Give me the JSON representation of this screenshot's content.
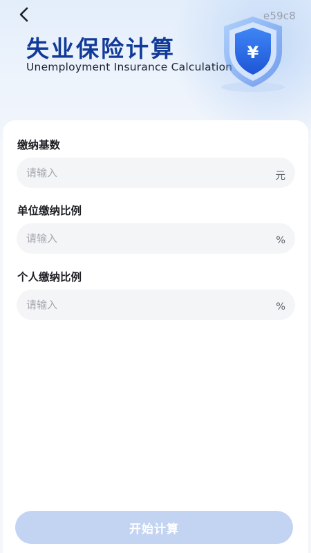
{
  "header": {
    "tag": "e59c8",
    "title": "失业保险计算",
    "subtitle": "Unemployment Insurance Calculation",
    "shield_symbol": "¥",
    "back_icon": "chevron-left-icon"
  },
  "form": {
    "fields": [
      {
        "label": "缴纳基数",
        "placeholder": "请输入",
        "unit": "元"
      },
      {
        "label": "单位缴纳比例",
        "placeholder": "请输入",
        "unit": "%"
      },
      {
        "label": "个人缴纳比例",
        "placeholder": "请输入",
        "unit": "%"
      }
    ]
  },
  "actions": {
    "start_label": "开始计算"
  },
  "colors": {
    "title": "#123a98",
    "button_disabled": "#c3d4f3",
    "field_bg": "#f4f5f7"
  }
}
